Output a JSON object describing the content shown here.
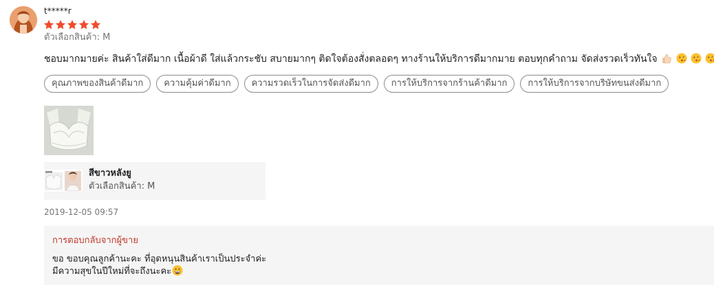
{
  "review": {
    "username": "t*****r",
    "rating": 5,
    "star_color": "#ee4d2d",
    "variation_line": "ตัวเลือกสินค้า: M",
    "comment": "ชอบมากมายค่ะ สินค้าใส่ดีมาก เนื้อผ้าดี ใส่แล้วกระชับ สบายมากๆ ติดใจต้องสั่งตลอดๆ ทางร้านให้บริการดีมากมาย ตอบทุกคำถาม จัดส่งรวดเร็วทันใจ",
    "comment_emojis": [
      "thumbs-up-icon",
      "kissing-face-icon",
      "kissing-face-icon",
      "kissing-face-icon"
    ],
    "tags": [
      "คุณภาพของสินค้าดีมาก",
      "ความคุ้มค่าดีมาก",
      "ความรวดเร็วในการจัดส่งดีมาก",
      "การให้บริการจากร้านค้าดีมาก",
      "การให้บริการจากบริษัทขนส่งดีมาก"
    ],
    "product": {
      "name": "สีขาวหลังยู",
      "variation": "ตัวเลือกสินค้า: M"
    },
    "timestamp": "2019-12-05 09:57",
    "seller_reply": {
      "title": "การตอบกลับจากผู้ขาย",
      "lines": [
        "ขอ ขอบคุณลูกค้านะคะ ที่อุดหนุนสินค้าเราเป็นประจำค่ะ",
        "มีความสุขในปีใหม่ที่จะถึงนะคะ"
      ],
      "title_color": "#c0392b"
    }
  }
}
